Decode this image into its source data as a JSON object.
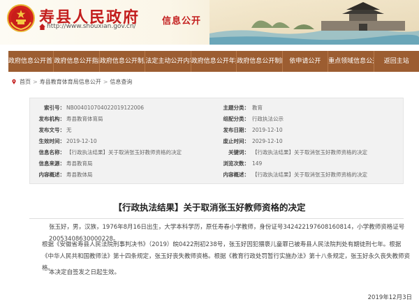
{
  "header": {
    "site_title": "寿县人民政府",
    "url": "http://www.shouxian.gov.cn/",
    "section_title": "信息公开"
  },
  "nav": {
    "items": [
      "政府信息公开首页",
      "政府信息公开指南",
      "政府信息公开制度",
      "法定主动公开内容",
      "政府信息公开年报",
      "政府信息公开制度",
      "依申请公开",
      "重点领域信息公开",
      "返回主站"
    ]
  },
  "breadcrumb": {
    "items": [
      "首页",
      "寿县教育体育局信息公开",
      "信息查询"
    ]
  },
  "meta": {
    "labels": {
      "index_no": "索引号：",
      "topic": "主题分类：",
      "org": "发布机构：",
      "category": "组配分类：",
      "doc_no": "发布文号：",
      "pub_date": "发布日期：",
      "effective": "生效时间：",
      "expire": "废止时间：",
      "name": "信息名称：",
      "keywords": "关键词：",
      "source": "信息来源：",
      "views": "浏览次数：",
      "content_org": "内容概述："
    },
    "values": {
      "index_no": "NB004010704022019122006",
      "topic": "教育",
      "org": "寿县教育体育局",
      "category": "行政执法公示",
      "doc_no": "无",
      "pub_date": "2019-12-10",
      "effective": "2019-12-10",
      "expire": "2029-12-10",
      "name": "【行政执法结果】关于取消张玉好教师资格的决定",
      "keywords": "【行政执法结果】关于取消张玉好教师资格的决定",
      "source": "寿县教育局",
      "views": "149",
      "content_org": "寿县教体局",
      "summary": "【行政执法结果】关于取消张玉好教师资格的决定"
    }
  },
  "article": {
    "title": "【行政执法结果】关于取消张玉好教师资格的决定",
    "p1": "张玉好，男，汉族，1976年8月16日出生，大学本科学历，原任寿春小学教师，身份证号342422197608160814，小学教师资格证号20053408630000228。",
    "p2": "根据《安徽省寿县人民法院刑事判决书》（2019）皖0422刑初238号，张玉好因犯猥亵儿童罪已被寿县人民法院判处有期徒刑七年。根据《中华人民共和国教师法》第十四条规定，张玉好丧失教师资格。根据《教育行政处罚暂行实施办法》第十八条规定，张玉好永久丧失教师资格。",
    "p3": "本决定自签发之日起生效。",
    "date": "2019年12月3日"
  },
  "colors": {
    "brand_red": "#c31e1e",
    "nav_brown": "#9c5d31"
  }
}
